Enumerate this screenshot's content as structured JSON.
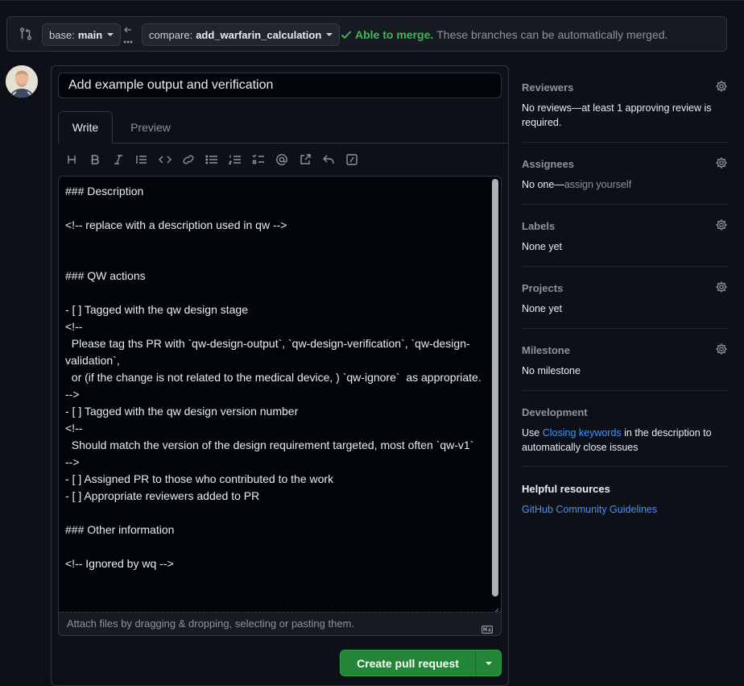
{
  "compare": {
    "base_prefix": "base:",
    "base_branch": "main",
    "compare_prefix": "compare:",
    "compare_branch": "add_warfarin_calculation",
    "merge_ok": "Able to merge.",
    "merge_msg": "These branches can be automatically merged."
  },
  "pr": {
    "title": "Add example output and verification",
    "tabs": [
      "Write",
      "Preview"
    ],
    "body": "### Description\n\n<!-- replace with a description used in qw -->\n\n\n### QW actions\n\n- [ ] Tagged with the qw design stage\n<!--\n  Please tag ths PR with `qw-design-output`, `qw-design-verification`, `qw-design-validation`,\n  or (if the change is not related to the medical device, ) `qw-ignore`  as appropriate.\n-->\n- [ ] Tagged with the qw design version number\n<!--\n  Should match the version of the design requirement targeted, most often `qw-v1`\n-->\n- [ ] Assigned PR to those who contributed to the work\n- [ ] Appropriate reviewers added to PR\n\n### Other information\n\n<!-- Ignored by wq -->",
    "attach_hint": "Attach files by dragging & dropping, selecting or pasting them.",
    "create_label": "Create pull request"
  },
  "toolbar": [
    "heading-icon",
    "bold-icon",
    "italic-icon",
    "quote-icon",
    "code-icon",
    "link-icon",
    "unordered-list-icon",
    "ordered-list-icon",
    "task-list-icon",
    "mention-icon",
    "cross-reference-icon",
    "reply-icon",
    "slash-commands-icon"
  ],
  "sidebar": {
    "reviewers": {
      "title": "Reviewers",
      "text": "No reviews—at least 1 approving review is required."
    },
    "assignees": {
      "title": "Assignees",
      "text_a": "No one—",
      "text_b": "assign yourself"
    },
    "labels": {
      "title": "Labels",
      "text": "None yet"
    },
    "projects": {
      "title": "Projects",
      "text": "None yet"
    },
    "milestone": {
      "title": "Milestone",
      "text": "No milestone"
    },
    "development": {
      "title": "Development",
      "text_a": "Use ",
      "link": "Closing keywords",
      "text_b": " in the description to automatically close issues"
    },
    "resources": {
      "title": "Helpful resources",
      "link": "GitHub Community Guidelines"
    }
  },
  "colors": {
    "accent_green": "#238636",
    "ok_green": "#3fb950",
    "link_blue": "#4493f8",
    "bg": "#0d1117"
  }
}
